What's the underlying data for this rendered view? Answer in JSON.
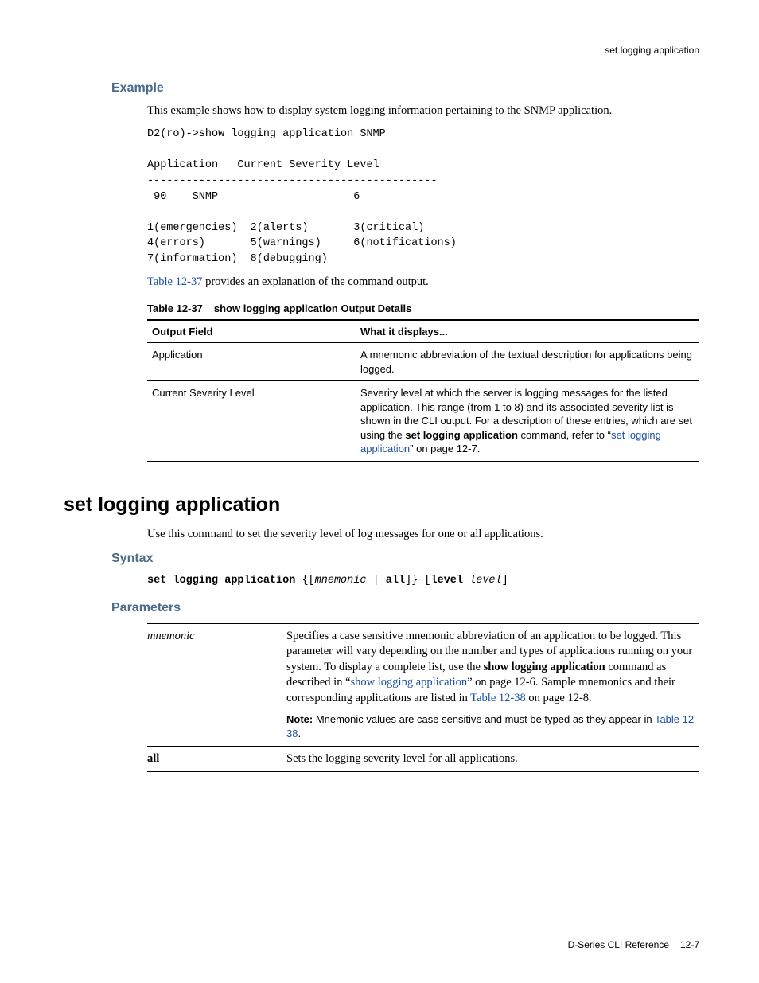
{
  "running_head": "set logging application",
  "example": {
    "heading": "Example",
    "intro": "This example shows how to display system logging information pertaining to the SNMP application.",
    "cli": "D2(ro)->show logging application SNMP\n\nApplication   Current Severity Level\n---------------------------------------------\n 90    SNMP                     6\n\n1(emergencies)  2(alerts)       3(critical)\n4(errors)       5(warnings)     6(notifications)\n7(information)  8(debugging)",
    "outro_pre": "Table 12-37",
    "outro_post": " provides an explanation of the command output."
  },
  "table37": {
    "number": "Table 12-37",
    "title": "show logging application Output Details",
    "head_col1": "Output Field",
    "head_col2": "What it displays...",
    "rows": {
      "r0c0": "Application",
      "r0c1": "A mnemonic abbreviation of the textual description for applications being logged.",
      "r1c0": "Current Severity Level",
      "r1c1_a": "Severity level at which the server is logging messages for the listed application. This range (from 1 to 8) and its associated severity list is shown in the CLI output. For a description of these entries, which are set using the ",
      "r1c1_bold": "set logging application",
      "r1c1_b": " command, refer to “",
      "r1c1_link": "set logging application",
      "r1c1_c": "” on page 12-7."
    }
  },
  "command": {
    "title": "set logging application",
    "desc": "Use this command to set the severity level of log messages for one or all applications."
  },
  "syntax": {
    "heading": "Syntax",
    "part_cmd": "set logging application",
    "part_brace_open": " {[",
    "part_mnemonic": "mnemonic",
    "part_pipe": " | ",
    "part_all": "all",
    "part_brace_close": "]} [",
    "part_level_kw": "level",
    "part_space": " ",
    "part_level_val": "level",
    "part_end": "]"
  },
  "parameters": {
    "heading": "Parameters",
    "mnemonic": {
      "name": "mnemonic",
      "desc_a": "Specifies a case sensitive mnemonic abbreviation of an application to be logged. This parameter will vary depending on the number and types of applications running on your system. To display a complete list, use the ",
      "desc_bold": "show logging application",
      "desc_b": " command as described in “",
      "desc_link1": "show logging application",
      "desc_c": "” on page 12-6. Sample mnemonics and their corresponding applications are listed in ",
      "desc_link2": "Table 12-38",
      "desc_d": " on page 12-8.",
      "note_label": "Note:",
      "note_text": " Mnemonic values are case sensitive and must be typed as they appear in ",
      "note_link": "Table 12-38",
      "note_end": "."
    },
    "all": {
      "name": "all",
      "desc": "Sets the logging severity level for all applications."
    }
  },
  "footer": {
    "doc": "D-Series CLI Reference",
    "page": "12-7"
  }
}
